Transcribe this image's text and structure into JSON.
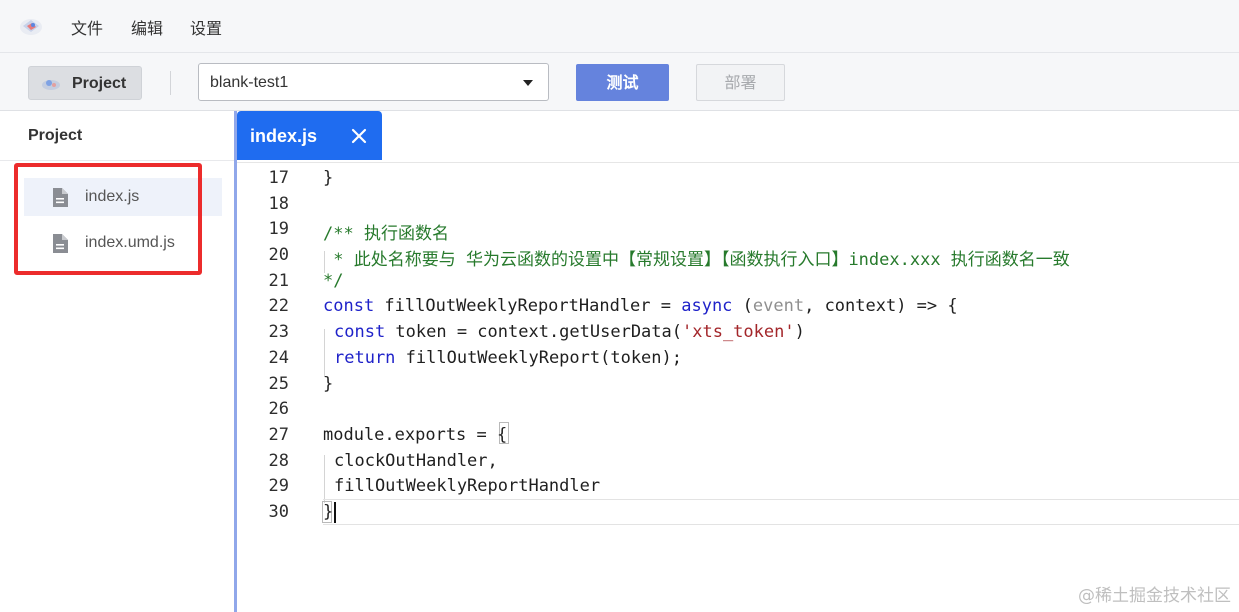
{
  "menubar": {
    "items": [
      "文件",
      "编辑",
      "设置"
    ]
  },
  "toolbar": {
    "project_label": "Project",
    "env_select_value": "blank-test1",
    "test_label": "测试",
    "deploy_label": "部署"
  },
  "sidebar": {
    "title": "Project",
    "files": [
      "index.js",
      "index.umd.js"
    ]
  },
  "editor": {
    "tab_label": "index.js",
    "line_numbers": [
      "17",
      "18",
      "19",
      "20",
      "21",
      "22",
      "23",
      "24",
      "25",
      "26",
      "27",
      "28",
      "29",
      "30"
    ],
    "lines": {
      "l17": "}",
      "l19": "/** 执行函数名",
      "l20": " * 此处名称要与 华为云函数的设置中【常规设置】【函数执行入口】index.xxx 执行函数名一致",
      "l21": "*/",
      "l22_kw1": "const",
      "l22_a": " fillOutWeeklyReportHandler = ",
      "l22_kw2": "async",
      "l22_b": " (",
      "l22_param": "event",
      "l22_c": ", context) => {",
      "l23_kw": "const",
      "l23_a": " token = context.getUserData(",
      "l23_str": "'xts_token'",
      "l23_b": ")",
      "l24_kw": "return",
      "l24_a": " fillOutWeeklyReport(token);",
      "l25": "}",
      "l27": "module.exports = {",
      "l28": "clockOutHandler,",
      "l29": "fillOutWeeklyReportHandler",
      "l30": "}"
    }
  },
  "watermark": "@稀土掘金技术社区",
  "colors": {
    "accent": "#1f6cf0",
    "test_button": "#6583dd",
    "highlight": "#ec2c2c",
    "keyword": "#1f22c9",
    "comment": "#277a2c",
    "string": "#a3262a"
  }
}
